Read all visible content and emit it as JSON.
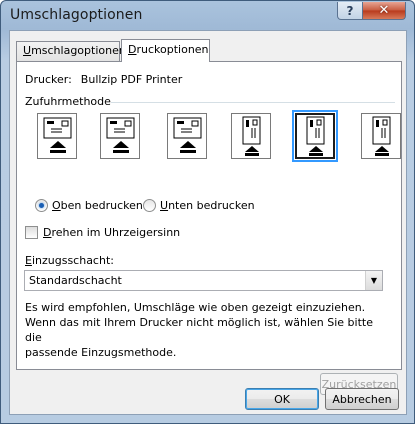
{
  "window": {
    "title": "Umschlagoptionen",
    "help_label": "?",
    "close_label": "✕"
  },
  "tabs": [
    {
      "label_pre": "",
      "label_key": "U",
      "label_post": "mschlagoptionen",
      "active": false
    },
    {
      "label_pre": "",
      "label_key": "D",
      "label_post": "ruckoptionen",
      "active": true
    }
  ],
  "printer": {
    "label": "Drucker:",
    "value": "Bullzip PDF Printer"
  },
  "feed_group": {
    "title": "Zufuhrmethode",
    "options": [
      {
        "name": "horizontal-left",
        "selected": false
      },
      {
        "name": "horizontal-center",
        "selected": false
      },
      {
        "name": "horizontal-right",
        "selected": false
      },
      {
        "name": "vertical-left",
        "selected": false
      },
      {
        "name": "vertical-center",
        "selected": true
      },
      {
        "name": "vertical-right",
        "selected": false
      }
    ]
  },
  "side": {
    "top_key": "O",
    "top_rest": "ben bedrucken",
    "top_selected": true,
    "bottom_key": "U",
    "bottom_rest": "nten bedrucken",
    "bottom_selected": false
  },
  "rotate": {
    "key": "D",
    "rest": "rehen im Uhrzeigersinn",
    "checked": false
  },
  "tray": {
    "label_key": "E",
    "label_rest": "inzugsschacht:",
    "value": "Standardschacht"
  },
  "info": {
    "line1": "Es wird empfohlen, Umschläge wie oben gezeigt einzuziehen.",
    "line2": "Wenn das mit Ihrem Drucker nicht möglich ist, wählen Sie bitte die",
    "line3": "passende Einzugsmethode."
  },
  "buttons": {
    "reset": "Zurücksetzen",
    "ok": "OK",
    "cancel": "Abbrechen"
  }
}
